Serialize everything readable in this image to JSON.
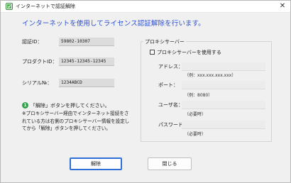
{
  "window": {
    "title": "インターネットで認証解除",
    "close_glyph": "✕"
  },
  "heading": "インターネットを使用してライセンス認証解除を行います。",
  "fields": {
    "auth_id": {
      "label": "認証ID：",
      "value": "59802-10307"
    },
    "product_id": {
      "label": "プロダクトID：",
      "value": "12345-12345-12345"
    },
    "serial_no": {
      "label": "シリアル№：",
      "value": "1234ABCD"
    }
  },
  "proxy": {
    "group_label": "プロキシサーバー",
    "use_proxy_label": "プロキシサーバーを使用する",
    "use_proxy_checked": false,
    "address_label": "アドレス：",
    "address_hint": "（例：xxx.xxx.xxx.xxx）",
    "port_label": "ポート：",
    "port_hint": "（例：8080）",
    "username_label": "ユーザ名：",
    "username_hint": "（必要時）",
    "password_label": "パスワード：",
    "password_hint": "（必要時）"
  },
  "info": {
    "icon_glyph": "1",
    "line1": "「解除」ボタンを押してください。",
    "note_lines": [
      "※プロキシサーバー経由でインターネット接続をさ",
      "れている方は右側のプロキシサーバー情報を設定し",
      "てから「解除」ボタンを押してください。"
    ]
  },
  "buttons": {
    "release": "解除",
    "close": "閉じる"
  },
  "colors": {
    "heading": "#2b4fd0",
    "info_icon": "#2fa24a",
    "primary_button_border": "#2d6fd6"
  }
}
